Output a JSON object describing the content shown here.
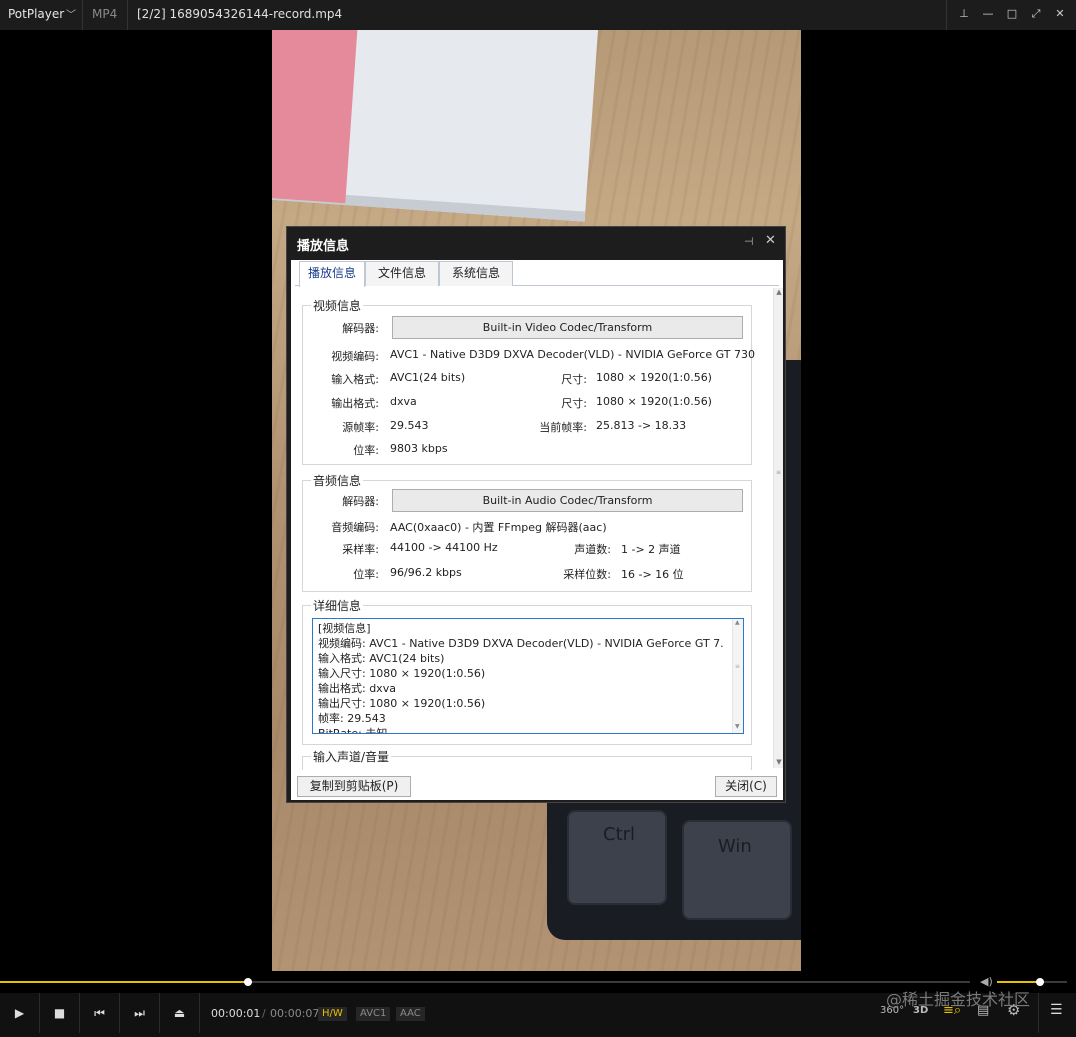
{
  "titlebar": {
    "app_name": "PotPlayer",
    "format": "MP4",
    "file": "[2/2] 1689054326144-record.mp4"
  },
  "video": {
    "key1": "Ctrl",
    "key2": "Win"
  },
  "dialog": {
    "title": "播放信息",
    "tabs": [
      "播放信息",
      "文件信息",
      "系统信息"
    ],
    "video_group": {
      "label": "视频信息",
      "decoder_label": "解码器:",
      "decoder_value": "Built-in Video Codec/Transform",
      "codec_label": "视频编码:",
      "codec_value": "AVC1 - Native D3D9 DXVA Decoder(VLD) - NVIDIA GeForce GT 730",
      "in_format_label": "输入格式:",
      "in_format_value": "AVC1(24 bits)",
      "in_size_label": "尺寸:",
      "in_size_value": "1080 × 1920(1:0.56)",
      "out_format_label": "输出格式:",
      "out_format_value": "dxva",
      "out_size_label": "尺寸:",
      "out_size_value": "1080 × 1920(1:0.56)",
      "src_fps_label": "源帧率:",
      "src_fps_value": "29.543",
      "cur_fps_label": "当前帧率:",
      "cur_fps_value": "25.813 -> 18.33",
      "bitrate_label": "位率:",
      "bitrate_value": "9803 kbps"
    },
    "audio_group": {
      "label": "音频信息",
      "decoder_label": "解码器:",
      "decoder_value": "Built-in Audio Codec/Transform",
      "codec_label": "音频编码:",
      "codec_value": "AAC(0xaac0) - 内置 FFmpeg 解码器(aac)",
      "samplerate_label": "采样率:",
      "samplerate_value": "44100 -> 44100 Hz",
      "channels_label": "声道数:",
      "channels_value": "1 -> 2 声道",
      "bitrate_label": "位率:",
      "bitrate_value": "96/96.2 kbps",
      "bits_label": "采样位数:",
      "bits_value": "16 -> 16 位"
    },
    "detail_group": {
      "label": "详细信息",
      "lines": [
        "[视频信息]",
        "  视频编码:    AVC1 - Native D3D9 DXVA Decoder(VLD) - NVIDIA GeForce GT 7.",
        "  输入格式:    AVC1(24 bits)",
        "  输入尺寸:    1080 × 1920(1:0.56)",
        "  输出格式:    dxva",
        "  输出尺寸:    1080 × 1920(1:0.56)",
        "  帧率:    29.543",
        "  BitRate:    未知"
      ]
    },
    "input_group": {
      "label": "输入声道/音量"
    },
    "copy_button": "复制到剪贴板(P)",
    "close_button": "关闭(C)"
  },
  "player": {
    "time_current": "00:00:01",
    "time_separator": "/",
    "time_total": "00:00:07",
    "badges": [
      "H/W",
      "AVC1",
      "AAC"
    ],
    "seek_progress": 0.256,
    "volume_level": 0.61,
    "right_icons": {
      "vr": "360°",
      "three_d": "3D"
    }
  },
  "watermark": "@稀土掘金技术社区",
  "colors": {
    "accent": "#e8c000",
    "badge_hw": "#e8c000",
    "badge_dim": "#8a8a8a"
  }
}
